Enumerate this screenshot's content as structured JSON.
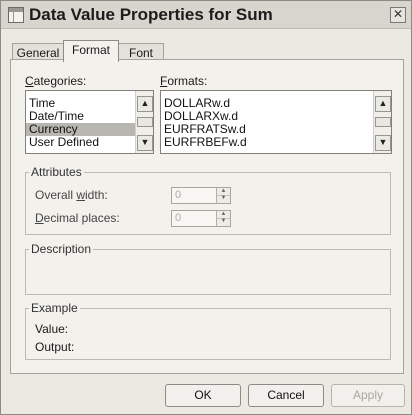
{
  "window": {
    "title": "Data Value Properties for Sum",
    "close_glyph": "✕"
  },
  "tabs": [
    {
      "label": "General",
      "active": false
    },
    {
      "label": "Format",
      "active": true
    },
    {
      "label": "Font",
      "active": false
    }
  ],
  "categories": {
    "label_first": "C",
    "label_rest": "ategories:",
    "items": [
      "Time",
      "Date/Time",
      "Currency",
      "User Defined"
    ],
    "selected": "Currency"
  },
  "formats": {
    "label_first": "F",
    "label_rest": "ormats:",
    "items": [
      "DOLLARw.d",
      "DOLLARXw.d",
      "EURFRATSw.d",
      "EURFRBEFw.d"
    ]
  },
  "attributes": {
    "legend": "Attributes",
    "overall_width_before": "Overall ",
    "overall_width_underlined": "w",
    "overall_width_after": "idth:",
    "overall_width_value": "0",
    "decimal_first": "D",
    "decimal_rest": "ecimal places:",
    "decimal_value": "0"
  },
  "description": {
    "legend": "Description"
  },
  "example": {
    "legend": "Example",
    "value_label": "Value:",
    "output_label": "Output:"
  },
  "buttons": {
    "ok": "OK",
    "cancel": "Cancel",
    "apply": "Apply"
  },
  "icons": {
    "scroll_up": "▲",
    "scroll_down": "▼",
    "spin_up": "▲",
    "spin_down": "▼"
  }
}
